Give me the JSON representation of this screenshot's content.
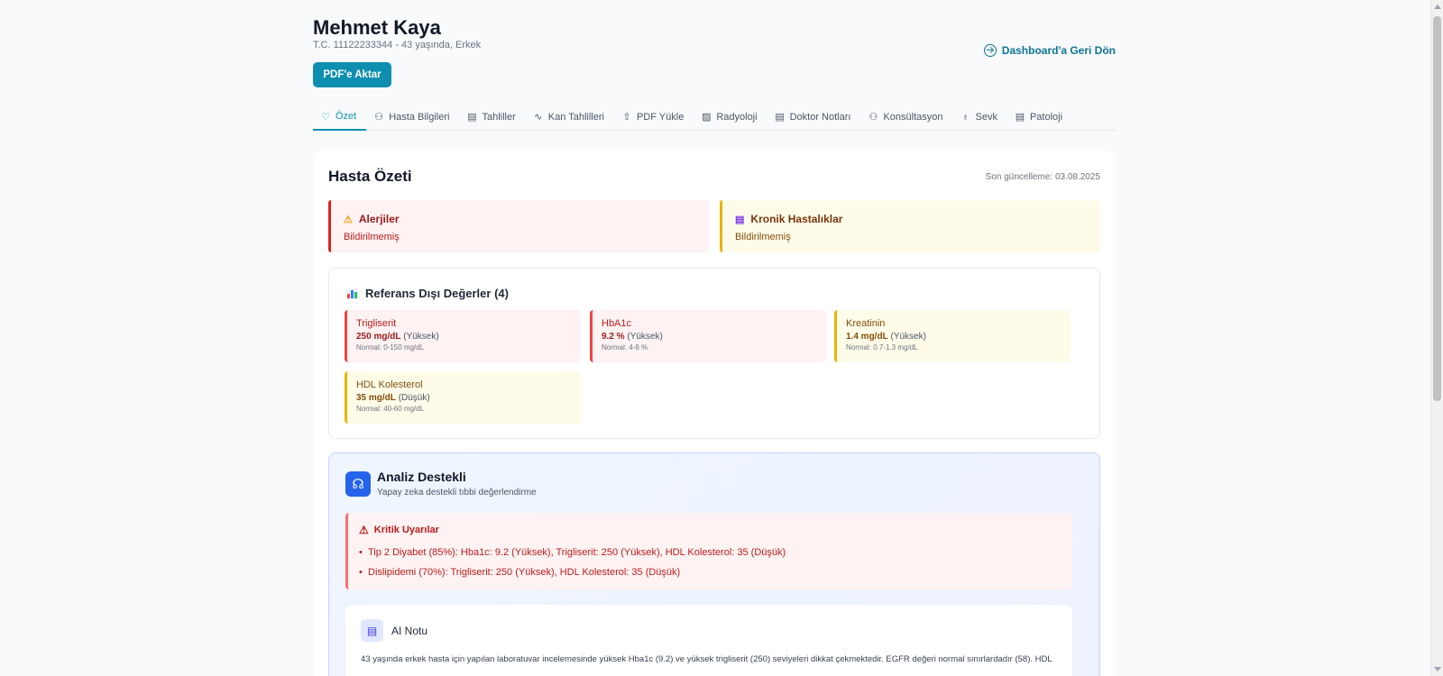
{
  "patient": {
    "name": "Mehmet Kaya",
    "meta": "T.C. 11122233344 - 43 yaşında, Erkek",
    "export_label": "PDF'e Aktar",
    "back_label": "Dashboard'a Geri Dön"
  },
  "tabs": [
    {
      "label": "Özet",
      "icon": "heart-pulse-icon",
      "active": true
    },
    {
      "label": "Hasta Bilgileri",
      "icon": "user-icon"
    },
    {
      "label": "Tahliller",
      "icon": "document-icon"
    },
    {
      "label": "Kan Tahlilleri",
      "icon": "activity-icon"
    },
    {
      "label": "PDF Yükle",
      "icon": "upload-icon"
    },
    {
      "label": "Radyoloji",
      "icon": "image-icon"
    },
    {
      "label": "Doktor Notları",
      "icon": "notes-icon"
    },
    {
      "label": "Konsültasyon",
      "icon": "users-icon"
    },
    {
      "label": "Sevk",
      "icon": "stethoscope-icon"
    },
    {
      "label": "Patoloji",
      "icon": "file-icon"
    }
  ],
  "summary": {
    "title": "Hasta Özeti",
    "last_update": "Son güncelleme: 03.08.2025",
    "allergies": {
      "title": "Alerjiler",
      "text": "Bildirilmemiş"
    },
    "chronic": {
      "title": "Kronik Hastalıklar",
      "text": "Bildirilmemiş"
    }
  },
  "out_of_range": {
    "title": "Referans Dışı Değerler (4)",
    "items": [
      {
        "name": "Trigliserit",
        "value": "250 mg/dL",
        "status": "(Yüksek)",
        "normal": "Normal: 0-150 mg/dL",
        "tone": "red"
      },
      {
        "name": "HbA1c",
        "value": "9.2 %",
        "status": "(Yüksek)",
        "normal": "Normal: 4-6 %",
        "tone": "red"
      },
      {
        "name": "Kreatinin",
        "value": "1.4 mg/dL",
        "status": "(Yüksek)",
        "normal": "Normal: 0.7-1.3 mg/dL",
        "tone": "yellow"
      },
      {
        "name": "HDL Kolesterol",
        "value": "35 mg/dL",
        "status": "(Düşük)",
        "normal": "Normal: 40-60 mg/dL",
        "tone": "yellow"
      }
    ]
  },
  "ai": {
    "title": "Analiz Destekli",
    "subtitle": "Yapay zeka destekli tıbbi değerlendirme",
    "critical_title": "Kritik Uyarılar",
    "critical_items": [
      "Tip 2 Diyabet (85%): Hba1c: 9.2 (Yüksek), Trigliserit: 250 (Yüksek), HDL Kolesterol: 35 (Düşük)",
      "Dislipidemi (70%): Trigliserit: 250 (Yüksek), HDL Kolesterol: 35 (Düşük)"
    ],
    "note_title": "AI Notu",
    "note_text": "43 yaşında erkek hasta için yapılan laboratuvar incelemesinde yüksek Hba1c (9.2) ve yüksek trigliserit (250) seviyeleri dikkat çekmektedir. EGFR değeri normal sınırlardadır (58). HDL"
  }
}
